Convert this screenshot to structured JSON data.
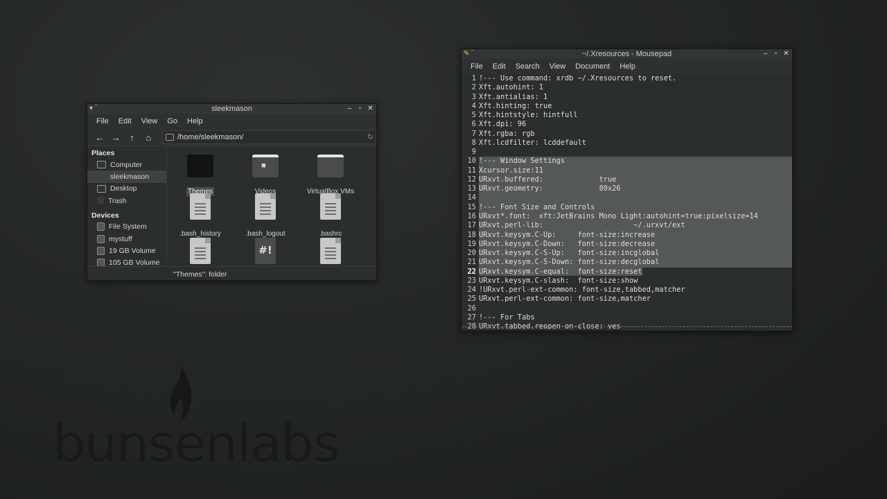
{
  "desktop": {
    "logo_text": "bunsenlabs"
  },
  "file_manager": {
    "title": "sleekmason",
    "menu": [
      "File",
      "Edit",
      "View",
      "Go",
      "Help"
    ],
    "path": "/home/sleekmason/",
    "places_header": "Places",
    "places": [
      {
        "label": "Computer",
        "icon": "computer-icon"
      },
      {
        "label": "sleekmason",
        "icon": "home-icon",
        "active": true
      },
      {
        "label": "Desktop",
        "icon": "desktop-icon"
      },
      {
        "label": "Trash",
        "icon": "trash-icon"
      }
    ],
    "devices_header": "Devices",
    "devices": [
      {
        "label": "File System",
        "icon": "drive-icon"
      },
      {
        "label": "mystuff",
        "icon": "drive-icon"
      },
      {
        "label": "19 GB Volume",
        "icon": "drive-icon"
      },
      {
        "label": "105 GB Volume",
        "icon": "drive-icon"
      },
      {
        "label": "16 GB Volume",
        "icon": "drive-icon"
      }
    ],
    "items": [
      {
        "label": "Themes",
        "icon": "folder-icon",
        "selected": true
      },
      {
        "label": "Videos",
        "icon": "video-folder-icon"
      },
      {
        "label": "VirtualBox VMs",
        "icon": "folder-icon"
      },
      {
        "label": ".bash_history",
        "icon": "text-file-icon"
      },
      {
        "label": ".bash_logout",
        "icon": "text-file-icon"
      },
      {
        "label": ".bashrc",
        "icon": "text-file-icon"
      },
      {
        "label": "",
        "icon": "text-file-icon"
      },
      {
        "label": "",
        "icon": "script-file-icon"
      },
      {
        "label": "",
        "icon": "text-file-icon"
      }
    ],
    "status": "\"Themes\": folder"
  },
  "mousepad": {
    "title": "~/.Xresources - Mousepad",
    "menu": [
      "File",
      "Edit",
      "Search",
      "View",
      "Document",
      "Help"
    ],
    "current_line": 22,
    "lines": [
      "!--- Use command: xrdb ~/.Xresources to reset.",
      "Xft.autohint: 1",
      "Xft.antialias: 1",
      "Xft.hinting: true",
      "Xft.hintstyle: hintfull",
      "Xft.dpi: 96",
      "Xft.rgba: rgb",
      "Xft.lcdfilter: lcddefault",
      "",
      "!--- Window Settings",
      "Xcursor.size:11",
      "URxvt.buffered:             true",
      "URxvt.geometry:             80x26",
      "",
      "!--- Font Size and Controls",
      "URxvt*.font:  xft:JetBrains Mono Light:autohint=true:pixelsize=14",
      "URxvt.perl-lib:                     ~/.urxvt/ext",
      "URxvt.keysym.C-Up:     font-size:increase",
      "URxvt.keysym.C-Down:   font-size:decrease",
      "URxvt.keysym.C-S-Up:   font-size:incglobal",
      "URxvt.keysym.C-S-Down: font-size:decglobal",
      "URxvt.keysym.C-equal:  font-size:reset",
      "URxvt.keysym.C-slash:  font-size:show",
      "!URxvt.perl-ext-common: font-size,tabbed,matcher",
      "URxvt.perl-ext-common: font-size,matcher",
      "",
      "!--- For Tabs",
      "URxvt.tabbed.reopen-on-close: yes"
    ],
    "selection_start": 10,
    "selection_end": 22
  }
}
